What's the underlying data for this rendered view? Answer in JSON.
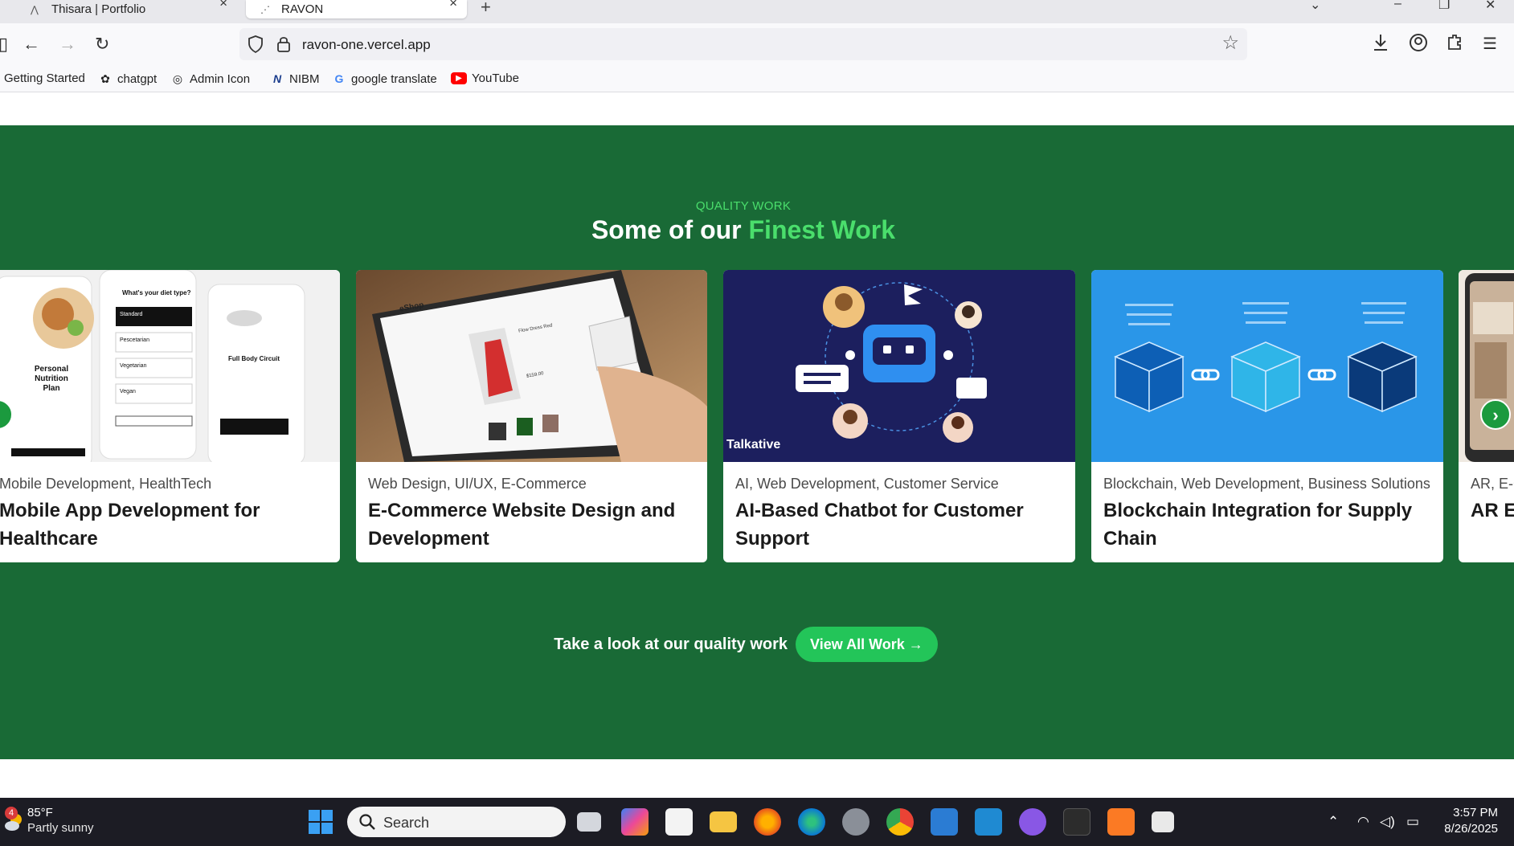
{
  "browser": {
    "tabs": [
      {
        "label": "Thisara | Portfolio",
        "active": false
      },
      {
        "label": "RAVON",
        "active": true
      }
    ],
    "url": "ravon-one.vercel.app",
    "bookmarks": [
      {
        "label": "Getting Started",
        "icon": "getting-started-icon"
      },
      {
        "label": "chatgpt",
        "icon": "chatgpt-icon"
      },
      {
        "label": "Admin Icon",
        "icon": "globe-icon"
      },
      {
        "label": "NIBM",
        "icon": "nibm-icon"
      },
      {
        "label": "google translate",
        "icon": "google-icon"
      },
      {
        "label": "YouTube",
        "icon": "youtube-icon"
      }
    ]
  },
  "section": {
    "eyebrow": "QUALITY WORK",
    "heading_prefix": "Some of our ",
    "heading_accent": "Finest Work",
    "accent_color": "#4ade6c",
    "background_color": "#196a36",
    "cards": [
      {
        "category": "Mobile Development, HealthTech",
        "title": "Mobile App Development for Healthcare",
        "image_text": [
          "What's your diet type?",
          "Standard",
          "Pescetarian",
          "Vegetarian",
          "Vegan",
          "Personal Nutrition Plan",
          "Full Body Circuit"
        ]
      },
      {
        "category": "Web Design, UI/UX, E-Commerce",
        "title": "E-Commerce Website Design and Development",
        "image_text": [
          "eShop",
          "Flow Dress Red",
          "$159.00"
        ]
      },
      {
        "category": "AI, Web Development, Customer Service",
        "title": "AI-Based Chatbot for Customer Support",
        "image_text": [
          "Talkative"
        ]
      },
      {
        "category": "Blockchain, Web Development, Business Solutions",
        "title": "Blockchain Integration for Supply Chain",
        "image_text": []
      },
      {
        "category": "AR, E-C",
        "title": "AR Ex",
        "image_text": []
      }
    ],
    "cta_text": "Take a look at our quality work",
    "cta_button": "View All Work →"
  },
  "taskbar": {
    "weather": {
      "temp": "85°F",
      "condition": "Partly sunny",
      "badge": "4"
    },
    "search_placeholder": "Search",
    "time": "3:57 PM",
    "date": "8/26/2025"
  }
}
